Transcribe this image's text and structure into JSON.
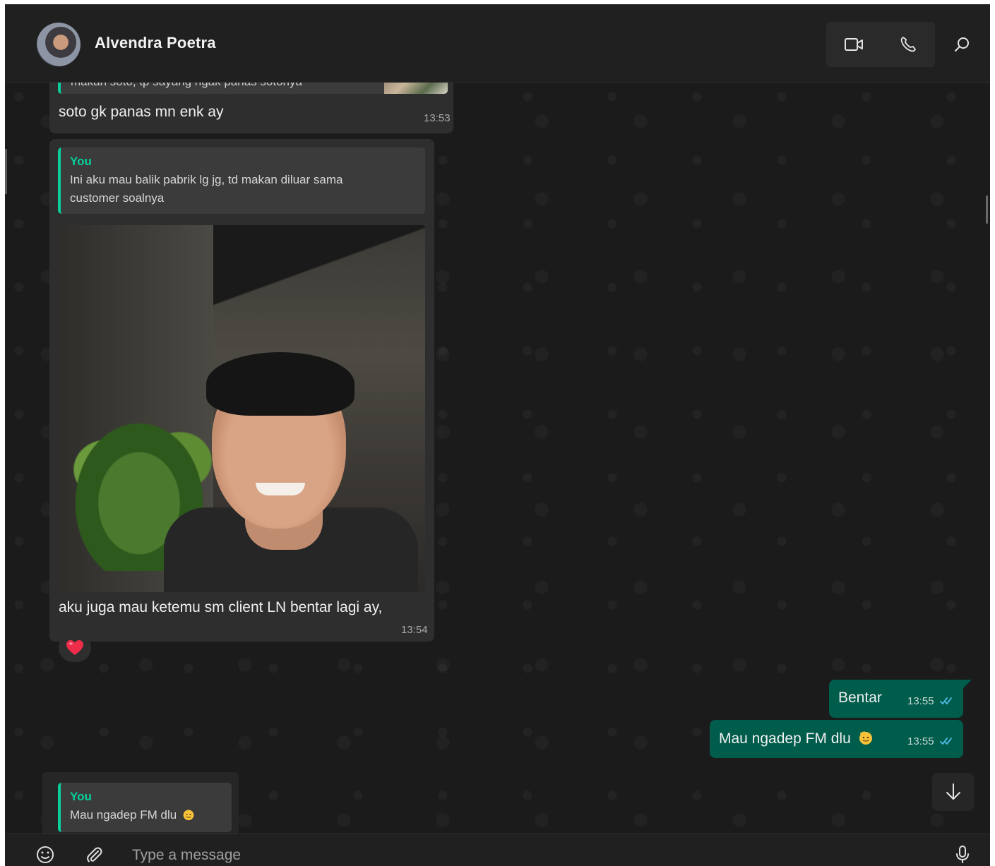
{
  "header": {
    "contact_name": "Alvendra Poetra"
  },
  "messages": {
    "m1": {
      "partial_quote_text": "makan soto, tp sayang ngak panas sotonya",
      "text": "soto gk panas mn enk ay",
      "time": "13:53"
    },
    "m2": {
      "quote_author": "You",
      "quote_text_line1": "Ini aku mau balik pabrik lg jg,  td makan diluar sama",
      "quote_text_line2": "customer soalnya",
      "caption": "aku juga mau ketemu sm client LN bentar lagi ay,",
      "time": "13:54",
      "reaction": "❤️"
    },
    "m3": {
      "text": "Bentar",
      "time": "13:55"
    },
    "m4": {
      "text": "Mau ngadep FM dlu",
      "time": "13:55"
    }
  },
  "reply_preview": {
    "author": "You",
    "text": "Mau ngadep FM dlu"
  },
  "composer": {
    "placeholder": "Type a message"
  },
  "colors": {
    "accent": "#06cf9c",
    "outgoing_bubble": "#005c4b",
    "incoming_bubble": "#2e2e2e",
    "read_ticks": "#53bdeb"
  },
  "icons": {
    "video": "video-call-icon",
    "call": "voice-call-icon",
    "search": "search-icon",
    "emoji": "emoji-icon",
    "attach": "attach-icon",
    "mic": "microphone-icon",
    "scroll": "arrow-down-icon"
  }
}
